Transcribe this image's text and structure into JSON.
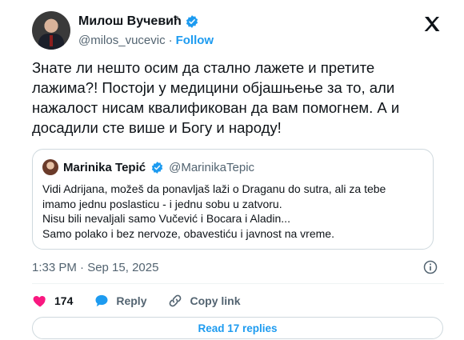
{
  "author": {
    "name": "Милош Вучевић",
    "handle": "@milos_vucevic",
    "separator": "·",
    "follow_label": "Follow"
  },
  "tweet": {
    "text": "Знате ли нешто осим да стално лажете и претите\nлажима?! Постоји у медицини објашњење за то, али\nнажалост нисам квалификован да вам помогнем. А и\nдосадили сте више и Богу и народу!"
  },
  "quote": {
    "name": "Marinika Tepić",
    "handle": "@MarinikaTepic",
    "text": "Vidi Adrijana, možeš da ponavljaš laži o Draganu do sutra, ali za tebe\nimamo jednu poslasticu - i jednu sobu u zatvoru.\nNisu bili nevaljali samo Vučević i Bocara i Aladin...\nSamo polako i bez nervoze, obavestiću i javnost na vreme."
  },
  "meta": {
    "timestamp": "1:33 PM · Sep 15, 2025"
  },
  "actions": {
    "likes": "174",
    "reply_label": "Reply",
    "copy_link_label": "Copy link"
  },
  "read_replies_label": "Read 17 replies",
  "colors": {
    "accent": "#1d9bf0",
    "like": "#f91880",
    "secondary_text": "#536471"
  },
  "icons": [
    "verified-badge-icon",
    "x-logo-icon",
    "info-icon",
    "heart-icon",
    "reply-bubble-icon",
    "link-icon"
  ]
}
